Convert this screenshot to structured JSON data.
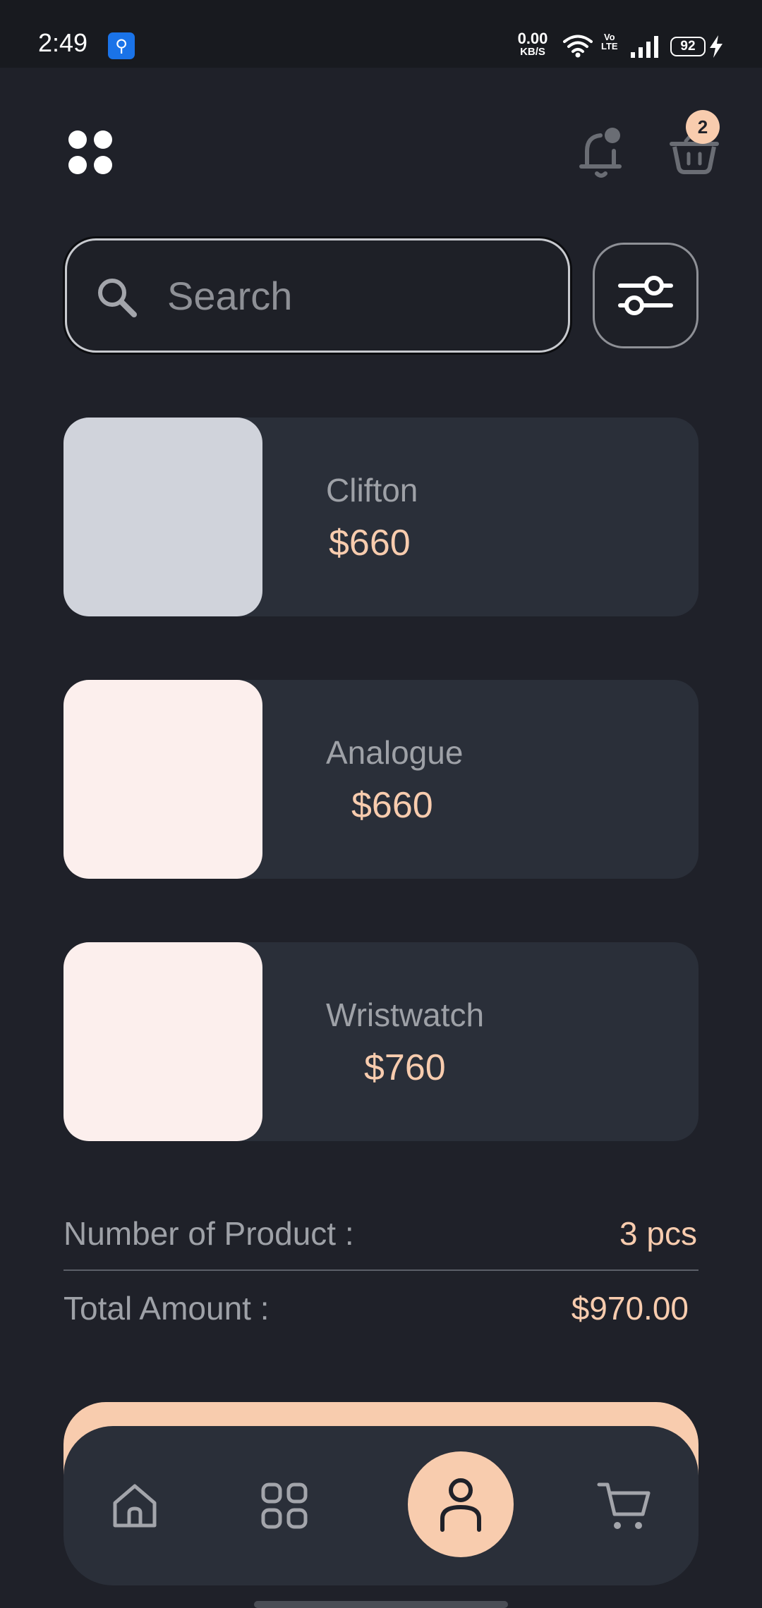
{
  "status_bar": {
    "time": "2:49",
    "usb_icon": "usb-icon",
    "net_speed_value": "0.00",
    "net_speed_unit": "KB/S",
    "volte_top": "Vo",
    "volte_bottom": "LTE",
    "battery": "92"
  },
  "header": {
    "menu_icon": "grid-dots-icon",
    "bell_icon": "bell-icon",
    "cart_icon": "basket-icon",
    "cart_count": "2"
  },
  "search": {
    "placeholder": "Search",
    "value": ""
  },
  "products": [
    {
      "name": "Clifton",
      "price": "$660",
      "image_color": "#d0d3db"
    },
    {
      "name": "Analogue",
      "price": "$660",
      "image_color": "#fcefed"
    },
    {
      "name": "Wristwatch",
      "price": "$760",
      "image_color": "#fcefed"
    }
  ],
  "summary": {
    "count_label": "Number of Product  :",
    "count_value": "3 pcs",
    "total_label": "Total Amount  :",
    "total_value": "$970.00"
  },
  "bottom_nav": {
    "items": [
      {
        "icon": "home-icon",
        "active": false
      },
      {
        "icon": "grid-icon",
        "active": false
      },
      {
        "icon": "user-icon",
        "active": true
      },
      {
        "icon": "cart-icon",
        "active": false
      }
    ]
  },
  "colors": {
    "background": "#1f2129",
    "card": "#2a2f39",
    "accent": "#f8ccae",
    "muted_text": "#9ea1a7"
  }
}
